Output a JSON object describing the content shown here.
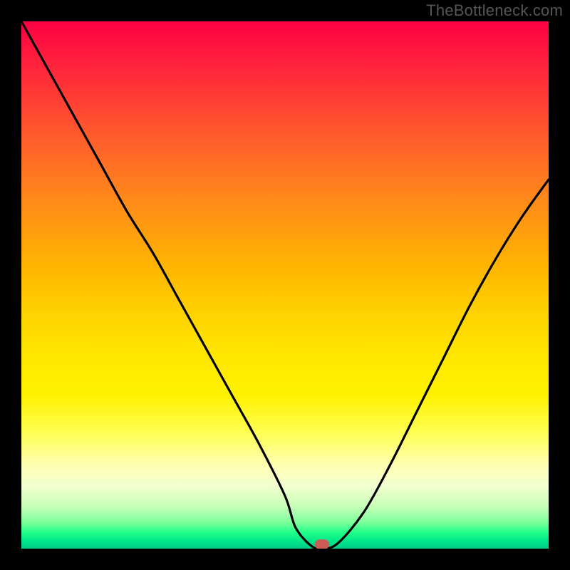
{
  "watermark": "TheBottleneck.com",
  "colors": {
    "frame_bg": "#000000",
    "curve_stroke": "#000000",
    "marker_fill": "#cc5d56",
    "gradient_top": "#ff0043",
    "gradient_bottom": "#00cc88"
  },
  "chart_data": {
    "type": "line",
    "title": "",
    "xlabel": "",
    "ylabel": "",
    "xlim": [
      0,
      100
    ],
    "ylim": [
      0,
      100
    ],
    "x": [
      0,
      5,
      10,
      15,
      20,
      25,
      30,
      35,
      40,
      45,
      50,
      52,
      55,
      57,
      60,
      65,
      70,
      75,
      80,
      85,
      90,
      95,
      100
    ],
    "values": [
      100,
      91,
      82,
      73,
      64,
      56,
      47,
      38,
      29,
      20,
      10,
      4,
      0.5,
      0,
      1,
      7,
      16,
      26,
      36,
      46,
      55,
      63,
      70
    ],
    "marker": {
      "x": 57,
      "y": 0
    },
    "note": "Values represent approximate curve height as a fraction (0-100) of the plot area height; x is horizontal position across the plot area. V-shaped bottleneck curve with minimum at x≈57."
  }
}
